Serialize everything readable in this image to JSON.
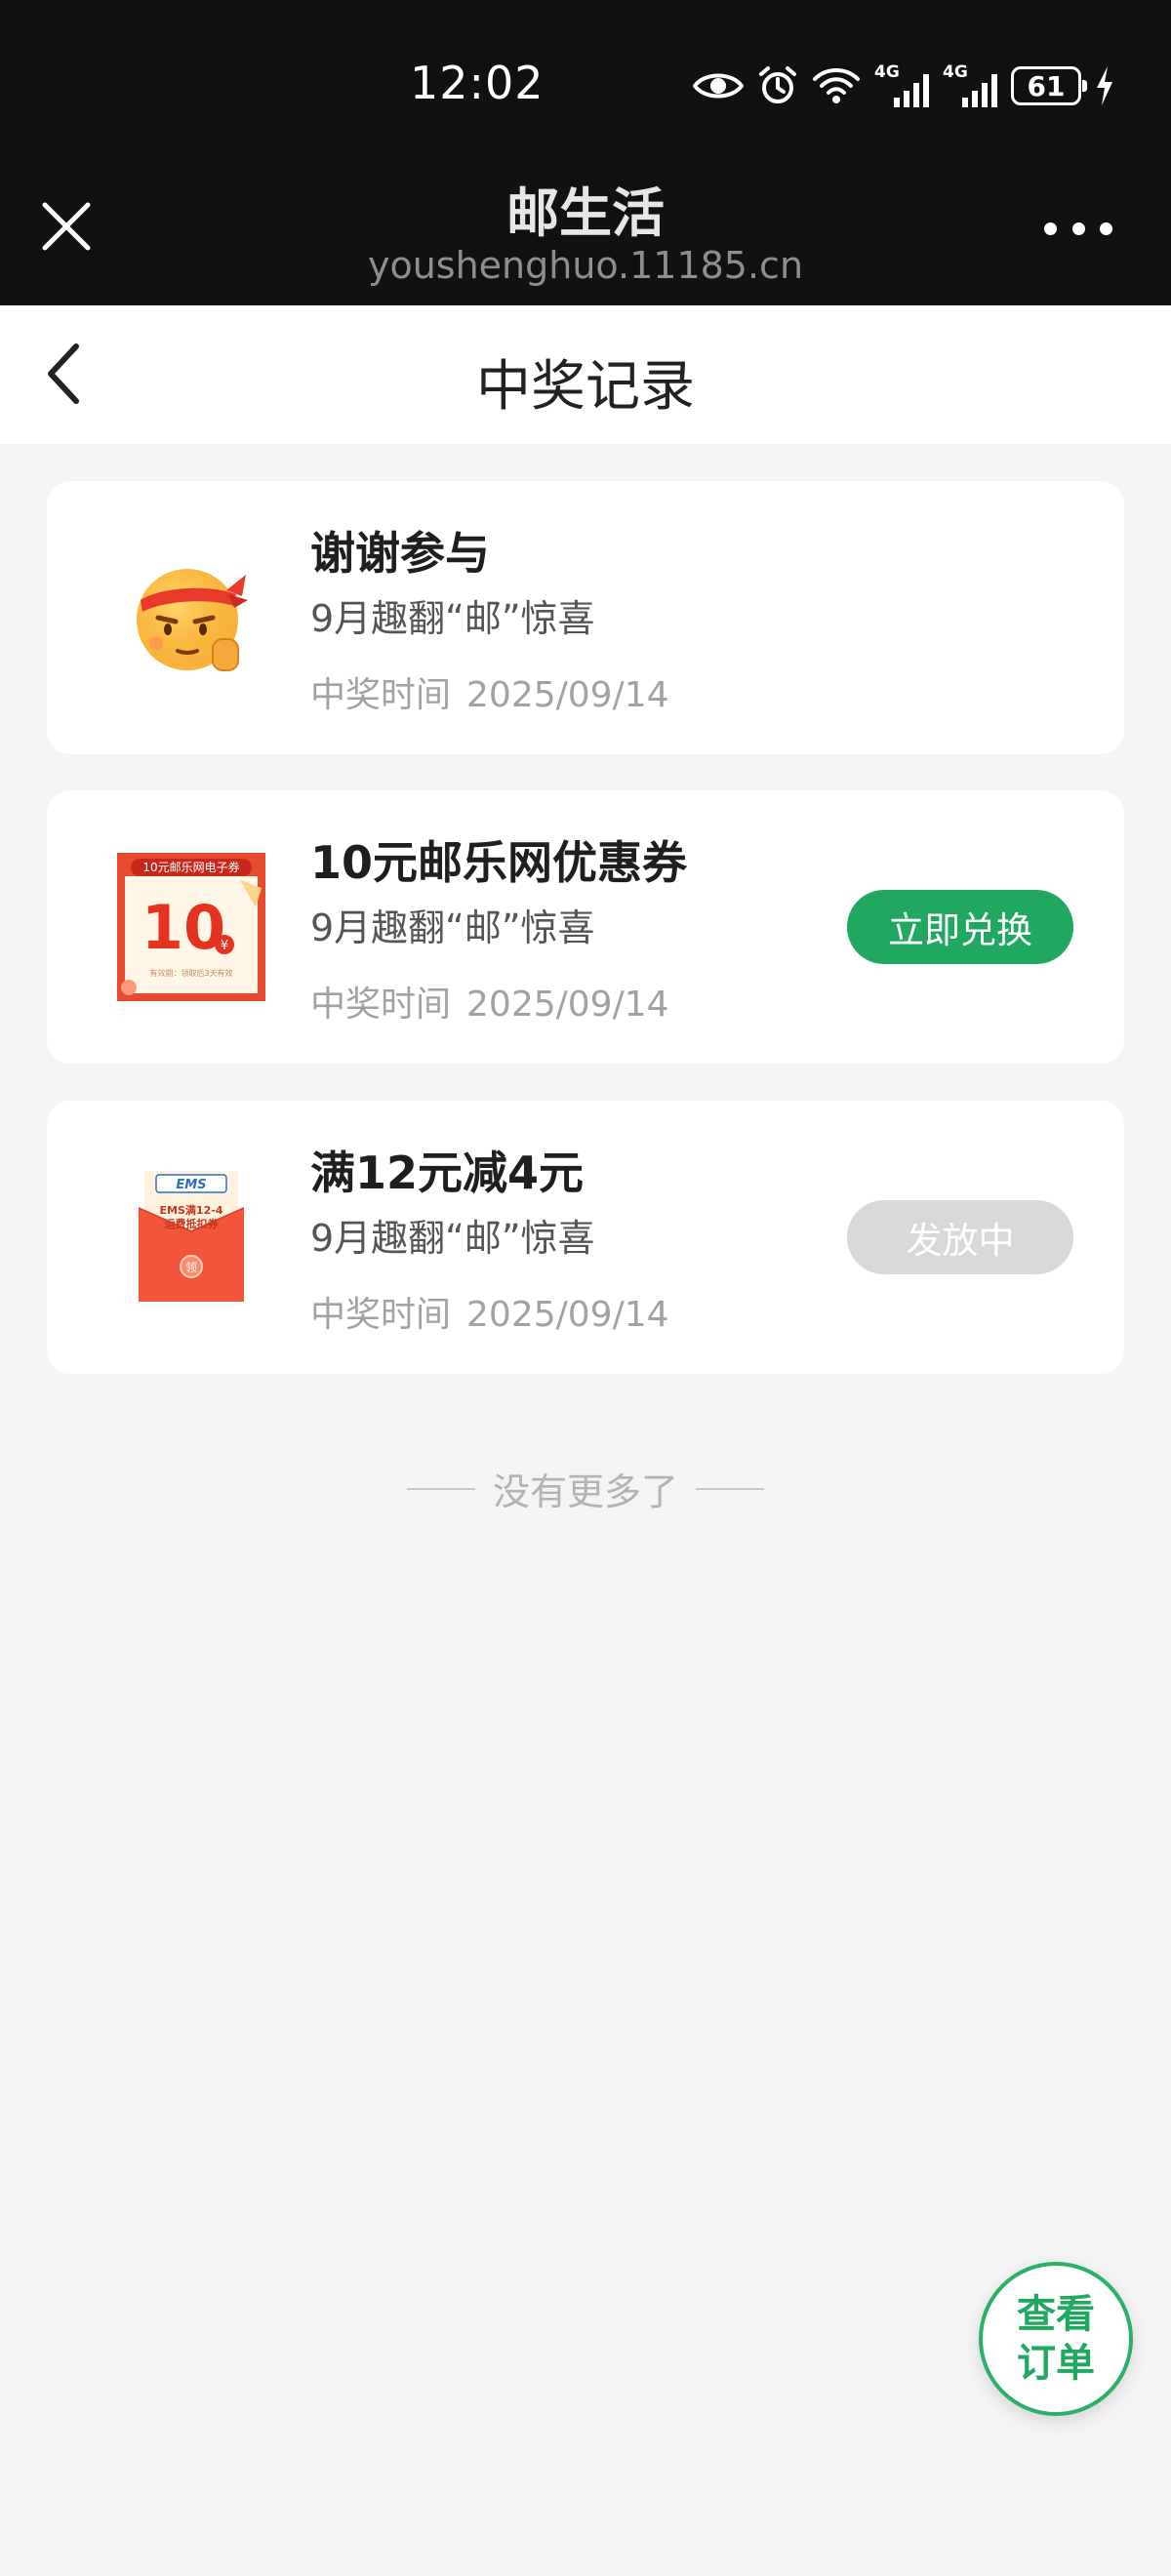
{
  "status_bar": {
    "time": "12:02",
    "battery": "61",
    "net1": "4G",
    "net2": "4G",
    "icons": [
      "eye-icon",
      "alarm-icon",
      "wifi-icon",
      "signal-icon",
      "signal-icon",
      "battery-icon",
      "charging-icon"
    ]
  },
  "webview": {
    "title": "邮生活",
    "url": "youshenghuo.11185.cn"
  },
  "page": {
    "title": "中奖记录"
  },
  "records": [
    {
      "title": "谢谢参与",
      "subtitle": "9月趣翻“邮”惊喜",
      "time_label": "中奖时间",
      "time_value": "2025/09/14",
      "image": "thank-you-emoji-icon"
    },
    {
      "title": "10元邮乐网优惠券",
      "subtitle": "9月趣翻“邮”惊喜",
      "time_label": "中奖时间",
      "time_value": "2025/09/14",
      "button": "立即兑换",
      "image": "coupon-card-icon",
      "image_text": {
        "banner": "10元邮乐网电子券",
        "amount": "10",
        "unit": "¥",
        "note": "有效期：领取后3天有效"
      }
    },
    {
      "title": "满12元减4元",
      "subtitle": "9月趣翻“邮”惊喜",
      "time_label": "中奖时间",
      "time_value": "2025/09/14",
      "button": "发放中",
      "image": "red-envelope-icon",
      "image_text": {
        "brand": "EMS",
        "line1": "EMS满12-4",
        "line2": "运费抵扣券",
        "seal": "领"
      }
    }
  ],
  "footer": {
    "no_more": "没有更多了"
  },
  "fab": {
    "line1": "查看",
    "line2": "订单"
  },
  "colors": {
    "accent": "#20a860",
    "header_bg": "#111111",
    "page_bg": "#f4f4f4"
  }
}
